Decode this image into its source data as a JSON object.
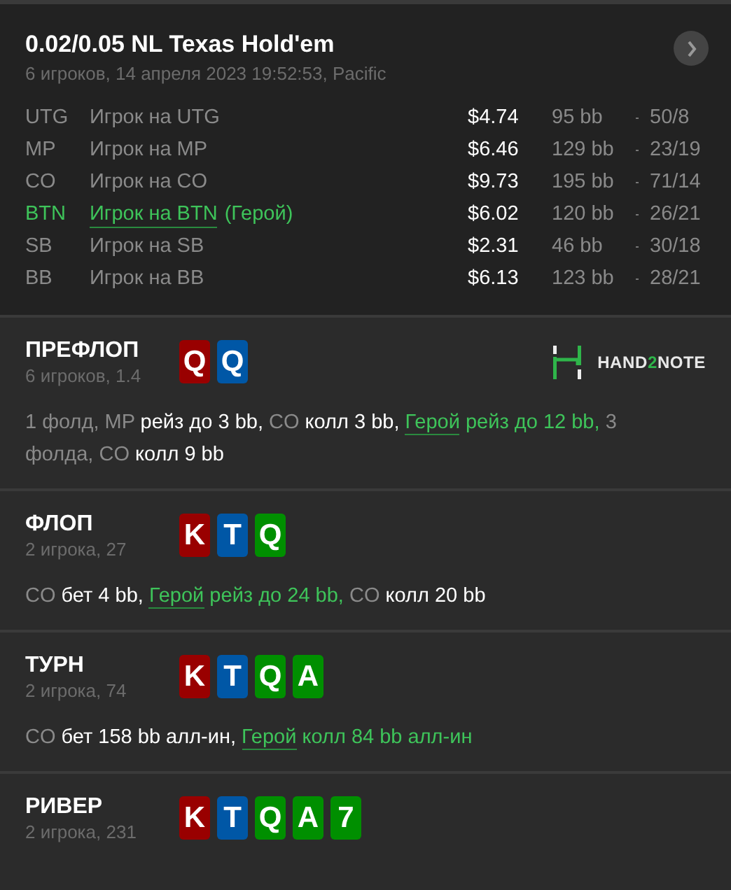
{
  "header": {
    "title": "0.02/0.05 NL Texas Hold'em",
    "subtitle": "6 игроков, 14 апреля 2023 19:52:53, Pacific"
  },
  "players": [
    {
      "position": "UTG",
      "name": "Игрок на UTG",
      "hero": false,
      "stack": "$4.74",
      "bb": "95 bb",
      "stats": "50/8"
    },
    {
      "position": "MP",
      "name": "Игрок на MP",
      "hero": false,
      "stack": "$6.46",
      "bb": "129 bb",
      "stats": "23/19"
    },
    {
      "position": "CO",
      "name": "Игрок на CO",
      "hero": false,
      "stack": "$9.73",
      "bb": "195 bb",
      "stats": "71/14"
    },
    {
      "position": "BTN",
      "name": "Игрок на BTN",
      "hero": true,
      "hero_tag": "(Герой)",
      "stack": "$6.02",
      "bb": "120 bb",
      "stats": "26/21"
    },
    {
      "position": "SB",
      "name": "Игрок на SB",
      "hero": false,
      "stack": "$2.31",
      "bb": "46 bb",
      "stats": "30/18"
    },
    {
      "position": "BB",
      "name": "Игрок на BB",
      "hero": false,
      "stack": "$6.13",
      "bb": "123 bb",
      "stats": "28/21"
    }
  ],
  "logo": {
    "before": "HAND",
    "accent": "2",
    "after": "NOTE"
  },
  "streets": [
    {
      "name": "ПРЕФЛОП",
      "info": "6 игроков, 1.4",
      "cards": [
        {
          "rank": "Q",
          "color": "#990000"
        },
        {
          "rank": "Q",
          "color": "#0057a6"
        }
      ],
      "actions": [
        {
          "kind": "actor",
          "text": "1 фолд, MP "
        },
        {
          "kind": "action",
          "text": "рейз до 3 bb, "
        },
        {
          "kind": "actor",
          "text": "CO "
        },
        {
          "kind": "action",
          "text": "колл 3 bb, "
        },
        {
          "kind": "hero",
          "text": "Герой"
        },
        {
          "kind": "hero_action",
          "text": " рейз до 12 bb, "
        },
        {
          "kind": "actor",
          "text": "3 фолда, CO "
        },
        {
          "kind": "action",
          "text": "колл 9 bb"
        }
      ]
    },
    {
      "name": "ФЛОП",
      "info": "2 игрока, 27",
      "cards": [
        {
          "rank": "K",
          "color": "#990000"
        },
        {
          "rank": "T",
          "color": "#0057a6"
        },
        {
          "rank": "Q",
          "color": "#008f00"
        }
      ],
      "actions": [
        {
          "kind": "actor",
          "text": "CO "
        },
        {
          "kind": "action",
          "text": "бет 4 bb, "
        },
        {
          "kind": "hero",
          "text": "Герой"
        },
        {
          "kind": "hero_action",
          "text": " рейз до 24 bb, "
        },
        {
          "kind": "actor",
          "text": "CO "
        },
        {
          "kind": "action",
          "text": "колл 20 bb"
        }
      ]
    },
    {
      "name": "ТУРН",
      "info": "2 игрока, 74",
      "cards": [
        {
          "rank": "K",
          "color": "#990000"
        },
        {
          "rank": "T",
          "color": "#0057a6"
        },
        {
          "rank": "Q",
          "color": "#008f00"
        },
        {
          "rank": "A",
          "color": "#008f00"
        }
      ],
      "actions": [
        {
          "kind": "actor",
          "text": "CO "
        },
        {
          "kind": "action",
          "text": "бет 158 bb алл-ин, "
        },
        {
          "kind": "hero",
          "text": "Герой"
        },
        {
          "kind": "hero_action",
          "text": " колл 84 bb алл-ин"
        }
      ]
    },
    {
      "name": "РИВЕР",
      "info": "2 игрока, 231",
      "cards": [
        {
          "rank": "K",
          "color": "#990000"
        },
        {
          "rank": "T",
          "color": "#0057a6"
        },
        {
          "rank": "Q",
          "color": "#008f00"
        },
        {
          "rank": "A",
          "color": "#008f00"
        },
        {
          "rank": "7",
          "color": "#008f00"
        }
      ]
    }
  ]
}
